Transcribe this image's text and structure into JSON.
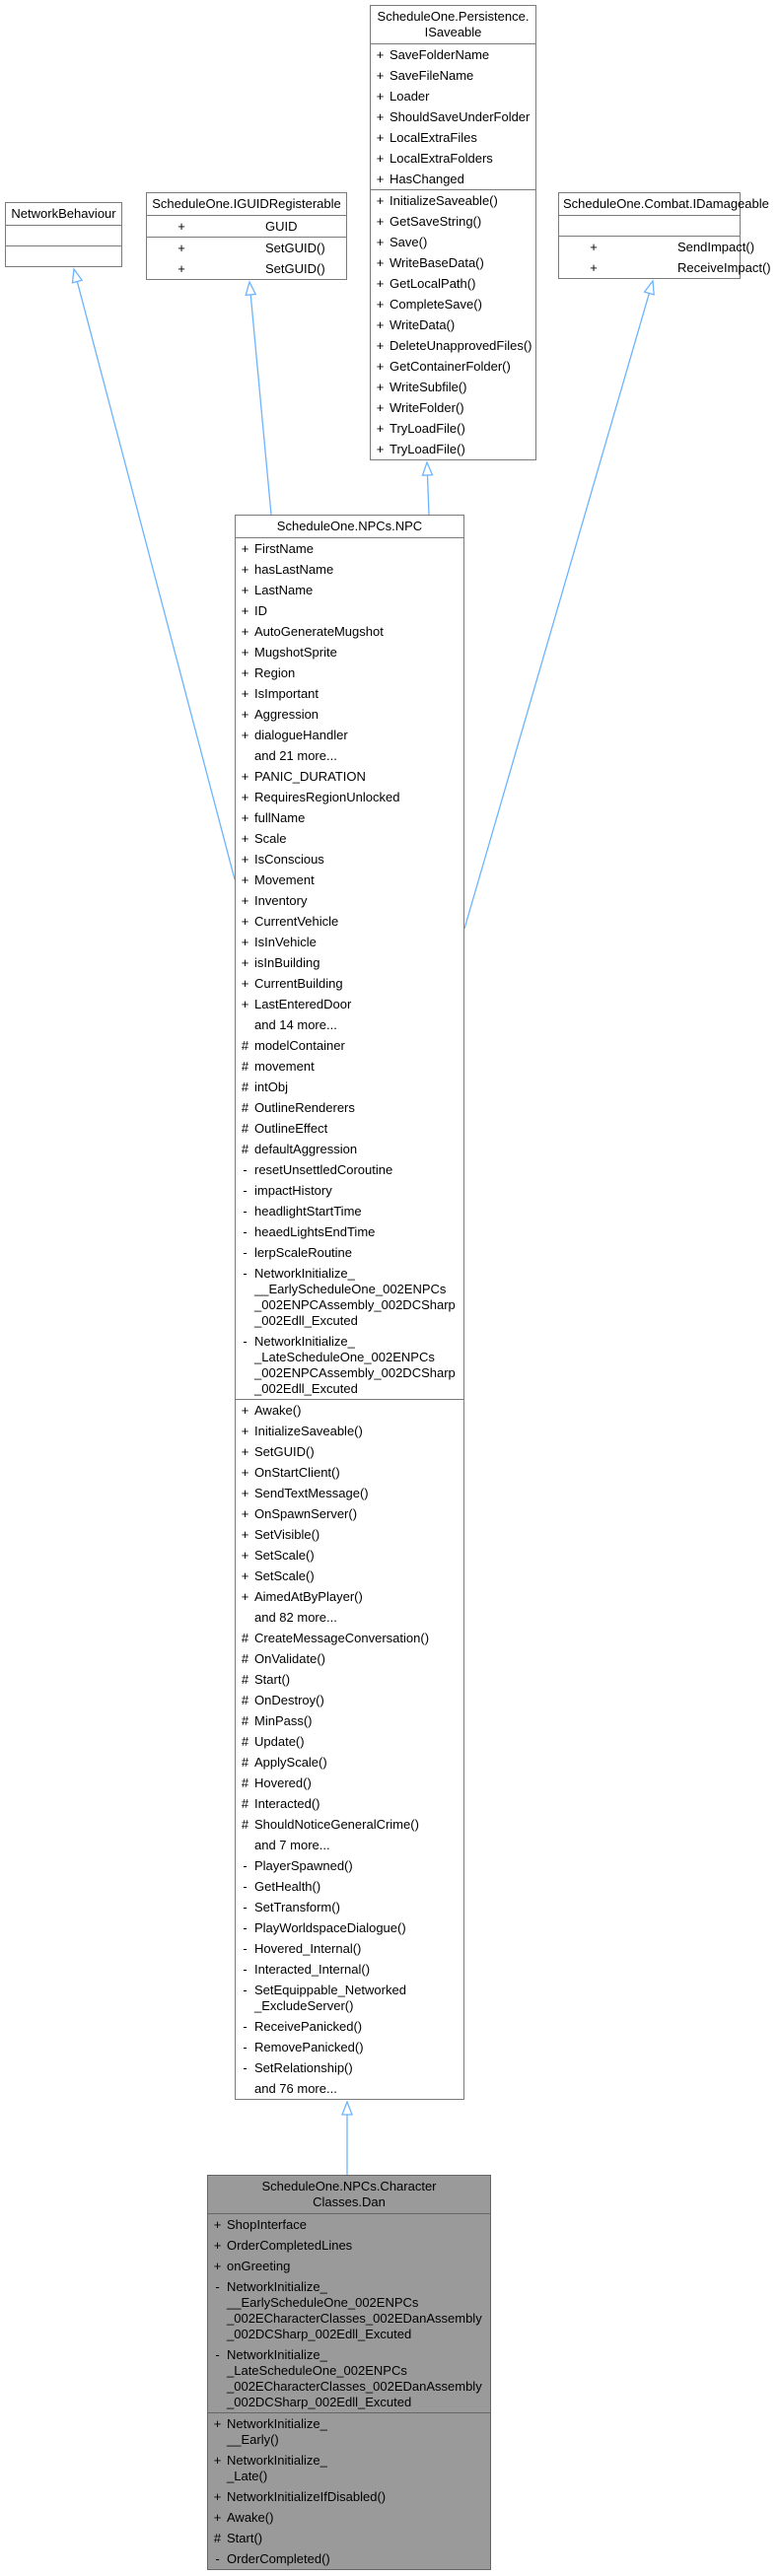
{
  "colors": {
    "arrow": "#6cb4ff",
    "focus_fill": "#9a9a9a",
    "border": "#7a7a7a"
  },
  "classes": {
    "network_behaviour": {
      "title": "NetworkBehaviour",
      "attributes": [],
      "methods": []
    },
    "iguid": {
      "title": "ScheduleOne.IGUIDRegisterable",
      "attributes": [
        {
          "v": "+",
          "n": "GUID"
        }
      ],
      "methods": [
        {
          "v": "+",
          "n": "SetGUID()"
        },
        {
          "v": "+",
          "n": "SetGUID()"
        }
      ]
    },
    "isaveable": {
      "title": "ScheduleOne.Persistence.\nISaveable",
      "attributes": [
        {
          "v": "+",
          "n": "SaveFolderName"
        },
        {
          "v": "+",
          "n": "SaveFileName"
        },
        {
          "v": "+",
          "n": "Loader"
        },
        {
          "v": "+",
          "n": "ShouldSaveUnderFolder"
        },
        {
          "v": "+",
          "n": "LocalExtraFiles"
        },
        {
          "v": "+",
          "n": "LocalExtraFolders"
        },
        {
          "v": "+",
          "n": "HasChanged"
        }
      ],
      "methods": [
        {
          "v": "+",
          "n": "InitializeSaveable()"
        },
        {
          "v": "+",
          "n": "GetSaveString()"
        },
        {
          "v": "+",
          "n": "Save()"
        },
        {
          "v": "+",
          "n": "WriteBaseData()"
        },
        {
          "v": "+",
          "n": "GetLocalPath()"
        },
        {
          "v": "+",
          "n": "CompleteSave()"
        },
        {
          "v": "+",
          "n": "WriteData()"
        },
        {
          "v": "+",
          "n": "DeleteUnapprovedFiles()"
        },
        {
          "v": "+",
          "n": "GetContainerFolder()"
        },
        {
          "v": "+",
          "n": "WriteSubfile()"
        },
        {
          "v": "+",
          "n": "WriteFolder()"
        },
        {
          "v": "+",
          "n": "TryLoadFile()"
        },
        {
          "v": "+",
          "n": "TryLoadFile()"
        }
      ]
    },
    "idamageable": {
      "title": "ScheduleOne.Combat.IDamageable",
      "attributes": [],
      "methods": [
        {
          "v": "+",
          "n": "SendImpact()"
        },
        {
          "v": "+",
          "n": "ReceiveImpact()"
        }
      ]
    },
    "npc": {
      "title": "ScheduleOne.NPCs.NPC",
      "attributes": [
        {
          "v": "+",
          "n": "FirstName"
        },
        {
          "v": "+",
          "n": "hasLastName"
        },
        {
          "v": "+",
          "n": "LastName"
        },
        {
          "v": "+",
          "n": "ID"
        },
        {
          "v": "+",
          "n": "AutoGenerateMugshot"
        },
        {
          "v": "+",
          "n": "MugshotSprite"
        },
        {
          "v": "+",
          "n": "Region"
        },
        {
          "v": "+",
          "n": "IsImportant"
        },
        {
          "v": "+",
          "n": "Aggression"
        },
        {
          "v": "+",
          "n": "dialogueHandler"
        },
        {
          "v": "",
          "n": "and 21 more..."
        },
        {
          "v": "+",
          "n": "PANIC_DURATION"
        },
        {
          "v": "+",
          "n": "RequiresRegionUnlocked"
        },
        {
          "v": "+",
          "n": "fullName"
        },
        {
          "v": "+",
          "n": "Scale"
        },
        {
          "v": "+",
          "n": "IsConscious"
        },
        {
          "v": "+",
          "n": "Movement"
        },
        {
          "v": "+",
          "n": "Inventory"
        },
        {
          "v": "+",
          "n": "CurrentVehicle"
        },
        {
          "v": "+",
          "n": "IsInVehicle"
        },
        {
          "v": "+",
          "n": "isInBuilding"
        },
        {
          "v": "+",
          "n": "CurrentBuilding"
        },
        {
          "v": "+",
          "n": "LastEnteredDoor"
        },
        {
          "v": "",
          "n": "and 14 more..."
        },
        {
          "v": "#",
          "n": "modelContainer"
        },
        {
          "v": "#",
          "n": "movement"
        },
        {
          "v": "#",
          "n": "intObj"
        },
        {
          "v": "#",
          "n": "OutlineRenderers"
        },
        {
          "v": "#",
          "n": "OutlineEffect"
        },
        {
          "v": "#",
          "n": "defaultAggression"
        },
        {
          "v": "-",
          "n": "resetUnsettledCoroutine"
        },
        {
          "v": "-",
          "n": "impactHistory"
        },
        {
          "v": "-",
          "n": "headlightStartTime"
        },
        {
          "v": "-",
          "n": "heaedLightsEndTime"
        },
        {
          "v": "-",
          "n": "lerpScaleRoutine"
        },
        {
          "v": "-",
          "n": "NetworkInitialize_\n__EarlyScheduleOne_002ENPCs\n_002ENPCAssembly_002DCSharp\n_002Edll_Excuted"
        },
        {
          "v": "-",
          "n": "NetworkInitialize_\n_LateScheduleOne_002ENPCs\n_002ENPCAssembly_002DCSharp\n_002Edll_Excuted"
        }
      ],
      "methods": [
        {
          "v": "+",
          "n": "Awake()"
        },
        {
          "v": "+",
          "n": "InitializeSaveable()"
        },
        {
          "v": "+",
          "n": "SetGUID()"
        },
        {
          "v": "+",
          "n": "OnStartClient()"
        },
        {
          "v": "+",
          "n": "SendTextMessage()"
        },
        {
          "v": "+",
          "n": "OnSpawnServer()"
        },
        {
          "v": "+",
          "n": "SetVisible()"
        },
        {
          "v": "+",
          "n": "SetScale()"
        },
        {
          "v": "+",
          "n": "SetScale()"
        },
        {
          "v": "+",
          "n": "AimedAtByPlayer()"
        },
        {
          "v": "",
          "n": "and 82 more..."
        },
        {
          "v": "#",
          "n": "CreateMessageConversation()"
        },
        {
          "v": "#",
          "n": "OnValidate()"
        },
        {
          "v": "#",
          "n": "Start()"
        },
        {
          "v": "#",
          "n": "OnDestroy()"
        },
        {
          "v": "#",
          "n": "MinPass()"
        },
        {
          "v": "#",
          "n": "Update()"
        },
        {
          "v": "#",
          "n": "ApplyScale()"
        },
        {
          "v": "#",
          "n": "Hovered()"
        },
        {
          "v": "#",
          "n": "Interacted()"
        },
        {
          "v": "#",
          "n": "ShouldNoticeGeneralCrime()"
        },
        {
          "v": "",
          "n": "and 7 more..."
        },
        {
          "v": "-",
          "n": "PlayerSpawned()"
        },
        {
          "v": "-",
          "n": "GetHealth()"
        },
        {
          "v": "-",
          "n": "SetTransform()"
        },
        {
          "v": "-",
          "n": "PlayWorldspaceDialogue()"
        },
        {
          "v": "-",
          "n": "Hovered_Internal()"
        },
        {
          "v": "-",
          "n": "Interacted_Internal()"
        },
        {
          "v": "-",
          "n": "SetEquippable_Networked\n_ExcludeServer()"
        },
        {
          "v": "-",
          "n": "ReceivePanicked()"
        },
        {
          "v": "-",
          "n": "RemovePanicked()"
        },
        {
          "v": "-",
          "n": "SetRelationship()"
        },
        {
          "v": "",
          "n": "and 76 more..."
        }
      ]
    },
    "dan": {
      "title": "ScheduleOne.NPCs.Character\nClasses.Dan",
      "attributes": [
        {
          "v": "+",
          "n": "ShopInterface"
        },
        {
          "v": "+",
          "n": "OrderCompletedLines"
        },
        {
          "v": "+",
          "n": "onGreeting"
        },
        {
          "v": "-",
          "n": "NetworkInitialize_\n__EarlyScheduleOne_002ENPCs\n_002ECharacterClasses_002EDanAssembly\n_002DCSharp_002Edll_Excuted"
        },
        {
          "v": "-",
          "n": "NetworkInitialize_\n_LateScheduleOne_002ENPCs\n_002ECharacterClasses_002EDanAssembly\n_002DCSharp_002Edll_Excuted"
        }
      ],
      "methods": [
        {
          "v": "+",
          "n": "NetworkInitialize_\n__Early()"
        },
        {
          "v": "+",
          "n": "NetworkInitialize_\n_Late()"
        },
        {
          "v": "+",
          "n": "NetworkInitializeIfDisabled()"
        },
        {
          "v": "+",
          "n": "Awake()"
        },
        {
          "v": "#",
          "n": "Start()"
        },
        {
          "v": "-",
          "n": "OrderCompleted()"
        }
      ]
    }
  }
}
